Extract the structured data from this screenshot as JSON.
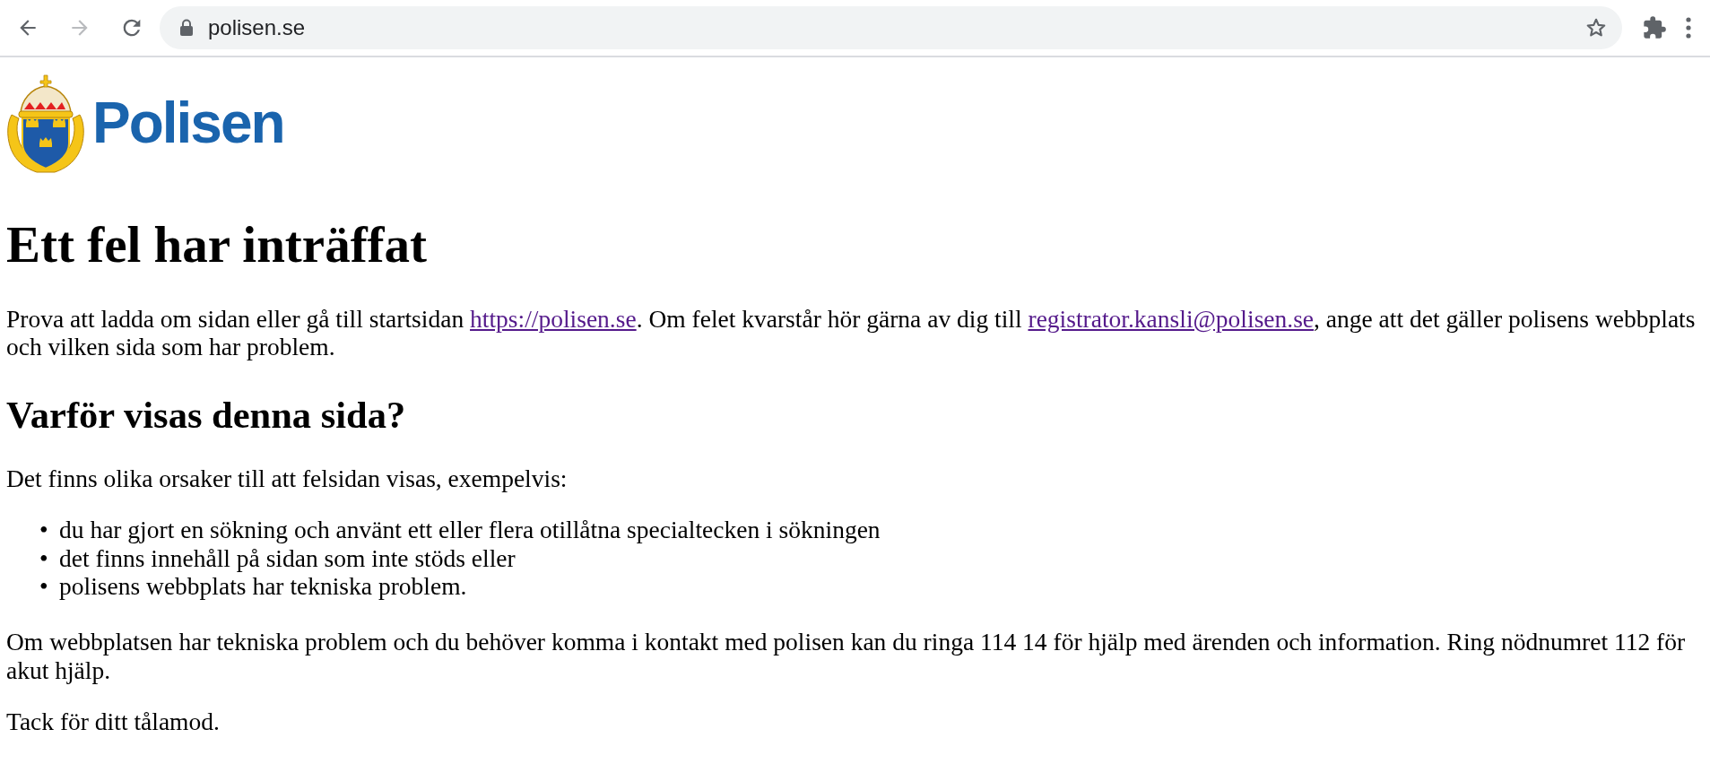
{
  "browser": {
    "back_disabled": false,
    "forward_disabled": true,
    "url": "polisen.se"
  },
  "logo": {
    "text": "Polisen"
  },
  "heading": "Ett fel har inträffat",
  "intro": [
    {
      "kind": "text",
      "text": "Prova att ladda om sidan eller gå till startsidan "
    },
    {
      "kind": "link",
      "text": "https://polisen.se",
      "visited": true
    },
    {
      "kind": "text",
      "text": ". Om felet kvarstår hör gärna av dig till "
    },
    {
      "kind": "link",
      "text": "registrator.kansli@polisen.se",
      "visited": true
    },
    {
      "kind": "text",
      "text": ", ange att det gäller polisens webbplats och vilken sida som har problem."
    }
  ],
  "subheading": "Varför visas denna sida?",
  "reasons_intro": "Det finns olika orsaker till att felsidan visas, exempelvis:",
  "reasons": [
    {
      "bullet": "•",
      "text": "du har gjort en sökning och använt ett eller flera otillåtna specialtecken i sökningen"
    },
    {
      "bullet": "•",
      "text": "det finns innehåll på sidan som inte stöds eller"
    },
    {
      "bullet": "•",
      "text": "polisens webbplats har tekniska problem."
    }
  ],
  "help": "Om webbplatsen har tekniska problem och du behöver komma i kontakt med polisen kan du ringa 114 14 för hjälp med ärenden och information. Ring nödnumret 112 för akut hjälp.",
  "thanks": "Tack för ditt tålamod."
}
